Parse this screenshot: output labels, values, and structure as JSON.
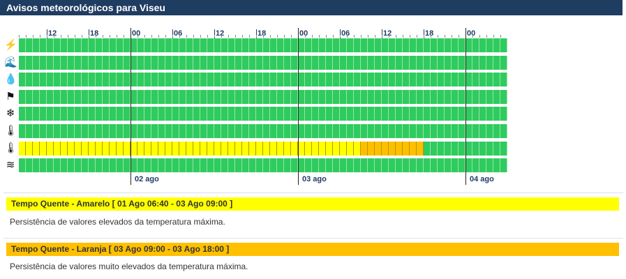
{
  "page": {
    "title": "Avisos meteorológicos para Viseu"
  },
  "timeline": {
    "hour_ticks": [
      "12",
      "18",
      "00",
      "06",
      "12",
      "18",
      "00",
      "06",
      "12",
      "18",
      "00"
    ],
    "day_labels": [
      "02 ago",
      "03 ago",
      "04 ago"
    ],
    "slots_per_row": 70,
    "rows": [
      {
        "icon": "lightning-icon",
        "glyph": "⚡",
        "levels": "G70"
      },
      {
        "icon": "coastal-wave-icon",
        "glyph": "🌊",
        "levels": "G70"
      },
      {
        "icon": "rain-drops-icon",
        "glyph": "💧",
        "levels": "G70"
      },
      {
        "icon": "wind-flag-icon",
        "glyph": "⚑",
        "levels": "G70"
      },
      {
        "icon": "snowflake-icon",
        "glyph": "❄",
        "levels": "G70"
      },
      {
        "icon": "cold-thermometer-icon",
        "glyph": "🌡",
        "levels": "G70"
      },
      {
        "icon": "hot-thermometer-icon",
        "glyph": "🌡",
        "levels": "Y49O9G12"
      },
      {
        "icon": "fog-icon",
        "glyph": "≋",
        "levels": "G70"
      }
    ],
    "colors": {
      "G": "#2ecc5f",
      "Y": "#ffff00",
      "O": "#ffbf00"
    }
  },
  "warnings": [
    {
      "title": "Tempo Quente - Amarelo [ 01 Ago 06:40 - 03 Ago 09:00 ]",
      "desc": "Persistência de valores elevados da temperatura máxima.",
      "color": "#ffff00"
    },
    {
      "title": "Tempo Quente - Laranja [ 03 Ago 09:00 - 03 Ago 18:00 ]",
      "desc": "Persistência de valores muito elevados da temperatura máxima.",
      "color": "#ffc000"
    }
  ]
}
